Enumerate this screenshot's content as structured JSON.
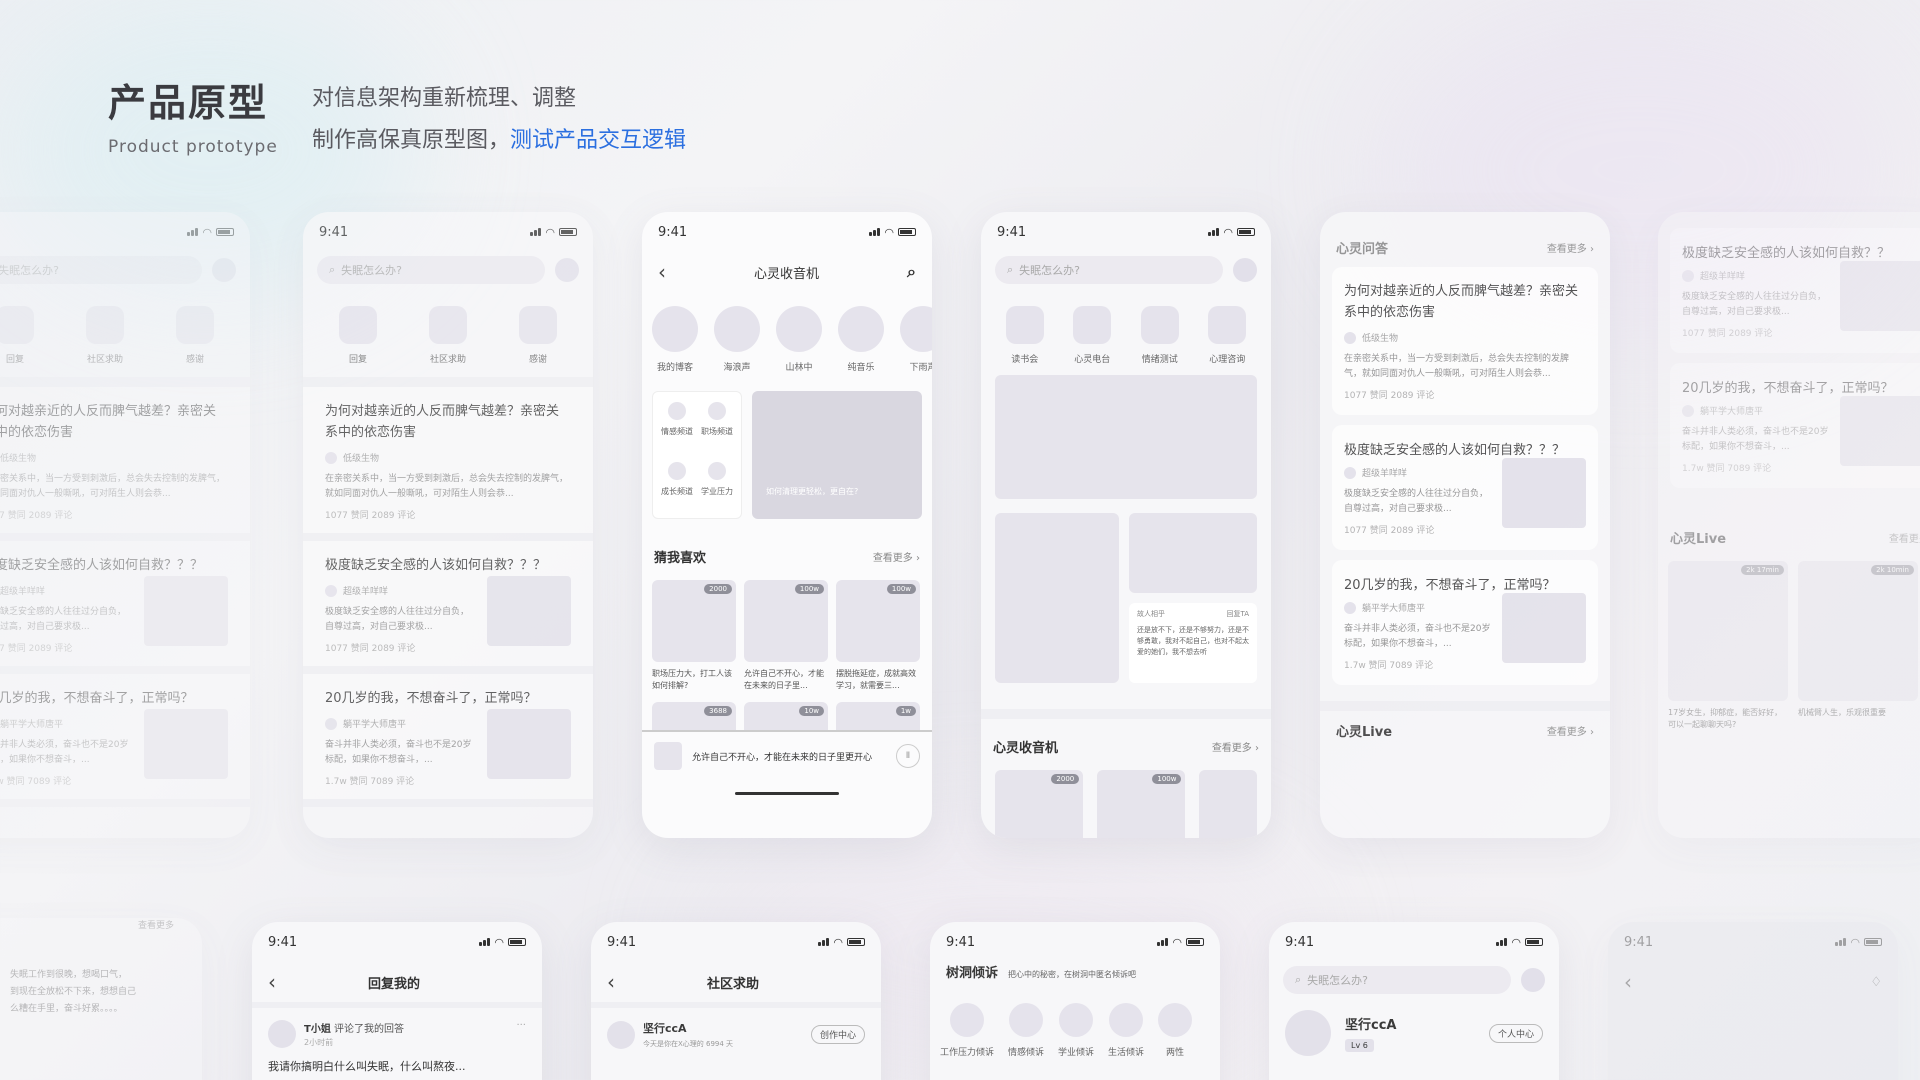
{
  "header": {
    "title": "产品原型",
    "subtitle": "Product prototype",
    "desc_line1": "对信息架构重新梳理、调整",
    "desc_line2_plain": "制作高保真原型图，",
    "desc_line2_highlight": "测试产品交互逻辑",
    "highlight_color": "#2b6fe0"
  },
  "status": {
    "time": "9:41"
  },
  "search_placeholder": "失眠怎么办?",
  "p1": {
    "icons": [
      "回复",
      "社区求助",
      "感谢"
    ],
    "posts": [
      {
        "title": "为何对越亲近的人反而脾气越差？亲密关系中的依恋伤害",
        "user": "低级生物",
        "body": "在亲密关系中，当一方受到刺激后，总会失去控制的发脾气，就如同面对仇人一般嘶吼，可对陌生人则会恭...",
        "meta": "1077 赞同    2089 评论"
      },
      {
        "title": "极度缺乏安全感的人该如何自救？？？",
        "user": "超级羊咩咩",
        "body": "极度缺乏安全感的人往往过分自负，自尊过高，对自己要求极...",
        "meta": "1077 赞同    2089 评论"
      },
      {
        "title": "20几岁的我，不想奋斗了，正常吗？",
        "user": "躺平学大师唐平",
        "body": "奋斗并非人类必须，奋斗也不是20岁标配，如果你不想奋斗，...",
        "meta": "1.7w 赞同    7089 评论"
      }
    ]
  },
  "p2": {
    "title": "心灵收音机",
    "circles": [
      "我的博客",
      "海浪声",
      "山林中",
      "纯音乐",
      "下雨声"
    ],
    "mini": [
      "情感频道",
      "职场频道",
      "成长频道",
      "学业压力"
    ],
    "banner_caption": "如何清理更轻松，更自在?",
    "section": "猜我喜欢",
    "more": "查看更多 ›",
    "tiles": [
      {
        "badge": "2000",
        "caption": "职场压力大，打工人该如何排解?"
      },
      {
        "badge": "100w",
        "caption": "允许自己不开心，才能在未来的日子里..."
      },
      {
        "badge": "100w",
        "caption": "摆脱拖延症，成就高效学习，就需要三..."
      }
    ],
    "tiles2": [
      "3688",
      "10w",
      "1w"
    ],
    "player": "允许自己不开心，才能在未来的日子里更开心",
    "play_icon": "Ⅱ"
  },
  "p3": {
    "icons": [
      "读书会",
      "心灵电台",
      "情绪测试",
      "心理咨询"
    ],
    "reply_user": "故人相乎",
    "reply_btn": "回复TA",
    "reply_body": "还是放不下，还是不够努力，还是不够勇敢，我对不起自己，也对不起太爱的她们，我不想去听",
    "section": "心灵收音机",
    "more": "查看更多 ›",
    "badges": [
      "2000",
      "100w"
    ]
  },
  "p4": {
    "section": "心灵问答",
    "more": "查看更多 ›",
    "posts": [
      {
        "title": "为何对越亲近的人反而脾气越差？亲密关系中的依恋伤害",
        "user": "低级生物",
        "body": "在亲密关系中，当一方受到刺激后，总会失去控制的发脾气，就如同面对仇人一般嘶吼，可对陌生人则会恭...",
        "meta": "1077 赞同    2089 评论"
      },
      {
        "title": "极度缺乏安全感的人该如何自救？？？",
        "user": "超级羊咩咩",
        "body": "极度缺乏安全感的人往往过分自负，自尊过高，对自己要求极...",
        "meta": "1077 赞同    2089 评论"
      },
      {
        "title": "20几岁的我，不想奋斗了，正常吗？",
        "user": "躺平学大师唐平",
        "body": "奋斗并非人类必须，奋斗也不是20岁标配，如果你不想奋斗，...",
        "meta": "1.7w 赞同    7089 评论"
      }
    ],
    "live": "心灵Live"
  },
  "p5": {
    "posts": [
      {
        "title": "极度缺乏安全感的人该如何自救？？",
        "user": "超级羊咩咩",
        "body": "极度缺乏安全感的人往往过分自负，自尊过高，对自己要求极...",
        "meta": "1077 赞同    2089 评论"
      },
      {
        "title": "20几岁的我，不想奋斗了，正常吗？",
        "user": "躺平学大师唐平",
        "body": "奋斗并非人类必须，奋斗也不是20岁标配，如果你不想奋斗，...",
        "meta": "1.7w 赞同    7089 评论"
      }
    ],
    "live": "心灵Live",
    "more": "查看更多 ›",
    "live_badges": [
      "2k 17min",
      "2k 10min"
    ],
    "live_caps": [
      "17岁女生，抑郁症，能否好好，可以一起聊聊天吗?",
      "机械臂人生，乐观很重要"
    ]
  },
  "b0": {
    "label": "查看更多",
    "lines": [
      "失眠工作到很晚，想喝口气，",
      "到现在全放松不下来，想想自己",
      "么糟在手里，奋斗好累。。。。"
    ]
  },
  "b1": {
    "title": "回复我的",
    "user": "T小姐",
    "action": "评论了我的回答",
    "time": "2小时前",
    "msg": "我请你搞明白什么叫失眠，什么叫熬夜...",
    "dots": "···"
  },
  "b2": {
    "title": "社区求助",
    "user": "坚行ccA",
    "sub": "今天是你在X心理的 6994 天",
    "btn": "创作中心"
  },
  "b3": {
    "title": "树洞倾诉",
    "sub": "把心中的秘密，在树洞中匿名倾诉吧",
    "icons": [
      "工作压力倾诉",
      "情感倾诉",
      "学业倾诉",
      "生活倾诉",
      "两性"
    ]
  },
  "b4": {
    "user": "坚行ccA",
    "level": "Lv 6",
    "btn": "个人中心"
  }
}
